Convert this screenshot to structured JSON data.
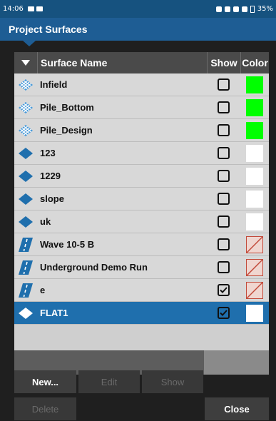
{
  "status_bar": {
    "time": "14:06",
    "battery": "35%"
  },
  "title": "Project Surfaces",
  "table": {
    "headers": {
      "name": "Surface Name",
      "show": "Show",
      "color": "Color"
    },
    "rows": [
      {
        "icon": "tin-mesh-icon",
        "name": "Infield",
        "show": false,
        "color": "#00ff00",
        "selected": false
      },
      {
        "icon": "tin-mesh-icon",
        "name": "Pile_Bottom",
        "show": false,
        "color": "#00ff00",
        "selected": false
      },
      {
        "icon": "tin-mesh-icon",
        "name": "Pile_Design",
        "show": false,
        "color": "#00ff00",
        "selected": false
      },
      {
        "icon": "plane-surface-icon",
        "name": "123",
        "show": false,
        "color": "#ffffff",
        "selected": false
      },
      {
        "icon": "plane-surface-icon",
        "name": "1229",
        "show": false,
        "color": "#ffffff",
        "selected": false
      },
      {
        "icon": "plane-surface-icon",
        "name": "slope",
        "show": false,
        "color": "#ffffff",
        "selected": false
      },
      {
        "icon": "plane-surface-icon",
        "name": "uk",
        "show": false,
        "color": "#ffffff",
        "selected": false
      },
      {
        "icon": "road-icon",
        "name": "Wave 10-5 B",
        "show": false,
        "color": "none",
        "selected": false
      },
      {
        "icon": "road-icon",
        "name": "Underground Demo Run",
        "show": false,
        "color": "none",
        "selected": false
      },
      {
        "icon": "road-icon",
        "name": "e",
        "show": true,
        "color": "none",
        "selected": false
      },
      {
        "icon": "plane-surface-icon",
        "name": "FLAT1",
        "show": true,
        "color": "#ffffff",
        "selected": true
      }
    ]
  },
  "buttons": {
    "new": "New...",
    "edit": "Edit",
    "show": "Show",
    "delete": "Delete",
    "close": "Close"
  }
}
